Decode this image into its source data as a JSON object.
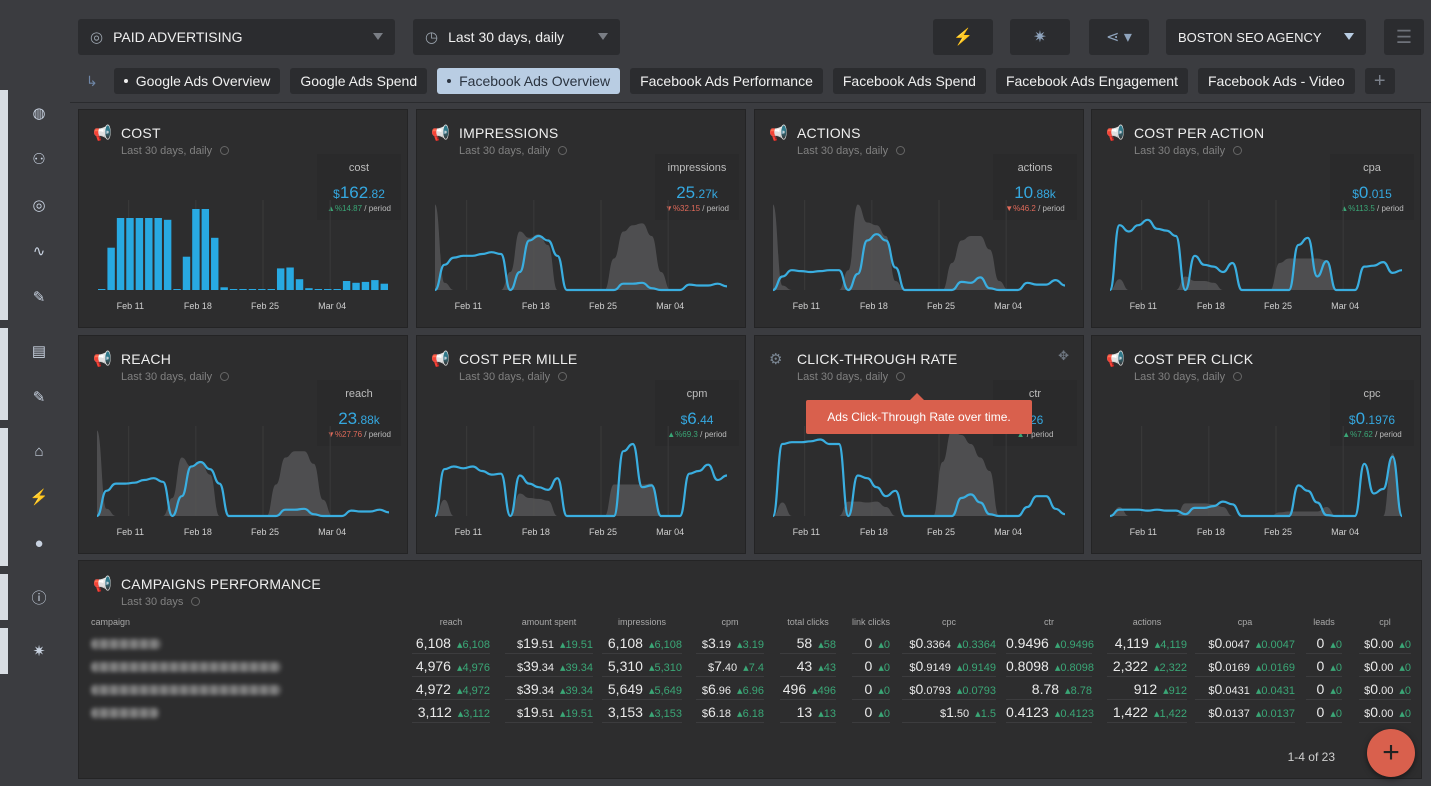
{
  "topbar": {
    "dashboard_select": {
      "label": "PAID ADVERTISING",
      "icon": "target-icon"
    },
    "period_select": {
      "label": "Last 30 days, daily",
      "icon": "clock-icon"
    },
    "buttons": [
      {
        "name": "plug-icon",
        "glyph": "⚡"
      },
      {
        "name": "bug-icon",
        "glyph": "✷"
      },
      {
        "name": "share-icon",
        "glyph": "⋖"
      }
    ],
    "agency_select": {
      "label": "BOSTON SEO AGENCY"
    },
    "menu_icon": "☰"
  },
  "tabs": [
    {
      "label": "Google Ads Overview",
      "dot": true,
      "active": false
    },
    {
      "label": "Google Ads Spend",
      "dot": false,
      "active": false
    },
    {
      "label": "Facebook Ads Overview",
      "dot": true,
      "active": true
    },
    {
      "label": "Facebook Ads Performance",
      "dot": false,
      "active": false
    },
    {
      "label": "Facebook Ads Spend",
      "dot": false,
      "active": false
    },
    {
      "label": "Facebook Ads Engagement",
      "dot": false,
      "active": false
    },
    {
      "label": "Facebook Ads - Video",
      "dot": false,
      "active": false
    }
  ],
  "tab_add": "+",
  "sidebar": [
    {
      "group": [
        {
          "name": "globe-icon",
          "g": "◍"
        },
        {
          "name": "users-icon",
          "g": "⚇"
        },
        {
          "name": "target-icon",
          "g": "◎"
        },
        {
          "name": "analytics-icon",
          "g": "∿"
        },
        {
          "name": "edit-icon",
          "g": "✎"
        }
      ]
    },
    {
      "group": [
        {
          "name": "clipboard-icon",
          "g": "▤"
        },
        {
          "name": "edit-icon",
          "g": "✎"
        }
      ]
    },
    {
      "group": [
        {
          "name": "bank-icon",
          "g": "⌂"
        },
        {
          "name": "plug-icon",
          "g": "⚡"
        },
        {
          "name": "account-icon",
          "g": "●"
        }
      ]
    },
    {
      "group": [
        {
          "name": "info-icon",
          "g": "ⓘ"
        }
      ]
    },
    {
      "group": [
        {
          "name": "bug-icon",
          "g": "✷"
        }
      ]
    }
  ],
  "widgets": [
    {
      "title": "COST",
      "subtitle": "Last 30 days, daily",
      "kpi_label": "cost",
      "prefix": "$",
      "value_main": "162",
      "value_dec": ".82",
      "change_dir": "up",
      "change": "%14.87",
      "period": " / period",
      "icon": "megaphone-icon"
    },
    {
      "title": "IMPRESSIONS",
      "subtitle": "Last 30 days, daily",
      "kpi_label": "impressions",
      "prefix": "",
      "value_main": "25",
      "value_dec": ".27k",
      "change_dir": "down",
      "change": "%32.15",
      "period": " / period",
      "icon": "megaphone-icon"
    },
    {
      "title": "ACTIONS",
      "subtitle": "Last 30 days, daily",
      "kpi_label": "actions",
      "prefix": "",
      "value_main": "10",
      "value_dec": ".88k",
      "change_dir": "down",
      "change": "%46.2",
      "period": " / period",
      "icon": "megaphone-icon"
    },
    {
      "title": "COST PER ACTION",
      "subtitle": "Last 30 days, daily",
      "kpi_label": "cpa",
      "prefix": "$",
      "value_main": "0",
      "value_dec": ".015",
      "change_dir": "up",
      "change": "%113.5",
      "period": " / period",
      "icon": "megaphone-icon"
    },
    {
      "title": "REACH",
      "subtitle": "Last 30 days, daily",
      "kpi_label": "reach",
      "prefix": "",
      "value_main": "23",
      "value_dec": ".88k",
      "change_dir": "down",
      "change": "%27.76",
      "period": " / period",
      "icon": "megaphone-icon"
    },
    {
      "title": "COST PER MILLE",
      "subtitle": "Last 30 days, daily",
      "kpi_label": "cpm",
      "prefix": "$",
      "value_main": "6",
      "value_dec": ".44",
      "change_dir": "up",
      "change": "%69.3",
      "period": " / period",
      "icon": "megaphone-icon"
    },
    {
      "title": "CLICK-THROUGH RATE",
      "subtitle": "Last 30 days, daily",
      "kpi_label": "ctr",
      "prefix": "",
      "value_main": "",
      "value_dec": ".26",
      "change_dir": "up",
      "change": "",
      "period": " / period",
      "icon": "gear-icon"
    },
    {
      "title": "COST PER CLICK",
      "subtitle": "Last 30 days, daily",
      "kpi_label": "cpc",
      "prefix": "$",
      "value_main": "0",
      "value_dec": ".1976",
      "change_dir": "up",
      "change": "%7.62",
      "period": " / period",
      "icon": "megaphone-icon"
    }
  ],
  "tooltip": "Ads Click-Through Rate over time.",
  "chart_data": [
    {
      "type": "bar",
      "title": "COST",
      "x_ticks": [
        "Feb 11",
        "Feb 18",
        "Feb 25",
        "Mar 04"
      ],
      "values": [
        0,
        47,
        80,
        80,
        80,
        80,
        80,
        78,
        0,
        37,
        90,
        90,
        58,
        3,
        0,
        0,
        0,
        0,
        0,
        24,
        25,
        12,
        2,
        0,
        0,
        0,
        10,
        8,
        9,
        11,
        7
      ]
    },
    {
      "type": "area",
      "title": "IMPRESSIONS",
      "x_ticks": [
        "Feb 11",
        "Feb 18",
        "Feb 25",
        "Mar 04"
      ],
      "line": [
        0,
        28,
        36,
        38,
        38,
        40,
        42,
        40,
        0,
        20,
        55,
        60,
        55,
        38,
        0,
        0,
        0,
        0,
        0,
        0,
        7,
        7,
        8,
        2,
        0,
        0,
        0,
        6,
        5,
        5,
        7,
        4
      ],
      "compare": [
        95,
        8,
        0,
        0,
        0,
        0,
        0,
        0,
        20,
        65,
        58,
        62,
        50,
        0,
        0,
        0,
        0,
        0,
        0,
        35,
        65,
        72,
        74,
        60,
        20,
        0,
        0,
        0,
        0,
        0,
        0,
        0
      ]
    },
    {
      "type": "area",
      "title": "ACTIONS",
      "x_ticks": [
        "Feb 11",
        "Feb 18",
        "Feb 25",
        "Mar 04"
      ],
      "line": [
        0,
        15,
        22,
        21,
        20,
        21,
        22,
        22,
        0,
        18,
        55,
        62,
        55,
        25,
        0,
        0,
        0,
        0,
        0,
        0,
        9,
        8,
        14,
        2,
        0,
        0,
        0,
        8,
        6,
        6,
        11,
        5
      ],
      "compare": [
        95,
        5,
        0,
        0,
        0,
        0,
        0,
        0,
        22,
        95,
        75,
        72,
        60,
        10,
        0,
        0,
        0,
        0,
        0,
        30,
        55,
        60,
        60,
        45,
        10,
        0,
        0,
        0,
        0,
        0,
        0,
        0
      ]
    },
    {
      "type": "area",
      "title": "COST PER ACTION",
      "x_ticks": [
        "Feb 11",
        "Feb 18",
        "Feb 25",
        "Mar 04"
      ],
      "line": [
        0,
        72,
        65,
        72,
        78,
        68,
        66,
        60,
        0,
        38,
        28,
        26,
        20,
        30,
        0,
        0,
        0,
        0,
        0,
        0,
        50,
        58,
        15,
        32,
        0,
        0,
        0,
        26,
        27,
        31,
        19,
        22
      ],
      "compare": [
        0,
        12,
        0,
        0,
        0,
        0,
        0,
        0,
        15,
        10,
        10,
        8,
        0,
        0,
        0,
        0,
        0,
        0,
        30,
        35,
        35,
        35,
        35,
        33,
        0,
        0,
        0,
        0,
        0,
        0,
        0,
        0
      ]
    },
    {
      "type": "area",
      "title": "REACH",
      "x_ticks": [
        "Feb 11",
        "Feb 18",
        "Feb 25",
        "Mar 04"
      ],
      "line": [
        0,
        28,
        36,
        36,
        37,
        40,
        42,
        38,
        0,
        22,
        55,
        60,
        52,
        36,
        0,
        0,
        0,
        0,
        0,
        0,
        7,
        7,
        8,
        2,
        0,
        0,
        0,
        6,
        5,
        5,
        7,
        4
      ],
      "compare": [
        95,
        8,
        0,
        0,
        0,
        0,
        0,
        0,
        20,
        65,
        55,
        60,
        46,
        0,
        0,
        0,
        0,
        0,
        0,
        35,
        65,
        72,
        72,
        58,
        18,
        0,
        0,
        0,
        0,
        0,
        0,
        0
      ]
    },
    {
      "type": "area",
      "title": "COST PER MILLE",
      "x_ticks": [
        "Feb 11",
        "Feb 18",
        "Feb 25",
        "Mar 04"
      ],
      "line": [
        0,
        52,
        55,
        53,
        55,
        50,
        46,
        47,
        0,
        45,
        36,
        32,
        29,
        42,
        0,
        0,
        0,
        0,
        0,
        0,
        72,
        80,
        32,
        34,
        0,
        0,
        0,
        47,
        50,
        57,
        40,
        45
      ],
      "compare": [
        0,
        18,
        0,
        0,
        0,
        0,
        0,
        0,
        0,
        25,
        20,
        19,
        17,
        0,
        0,
        0,
        0,
        0,
        0,
        35,
        35,
        35,
        35,
        36,
        0,
        0,
        0,
        0,
        0,
        0,
        0,
        0
      ]
    },
    {
      "type": "area",
      "title": "CLICK-THROUGH RATE",
      "x_ticks": [
        "Feb 11",
        "Feb 18",
        "Feb 25",
        "Mar 04"
      ],
      "line": [
        0,
        80,
        82,
        82,
        83,
        85,
        80,
        80,
        0,
        45,
        42,
        32,
        22,
        28,
        0,
        0,
        0,
        0,
        0,
        0,
        20,
        24,
        15,
        2,
        0,
        0,
        0,
        10,
        22,
        22,
        8,
        2
      ],
      "compare": [
        0,
        15,
        0,
        0,
        0,
        0,
        0,
        0,
        16,
        16,
        15,
        16,
        10,
        0,
        0,
        0,
        0,
        0,
        60,
        95,
        90,
        80,
        65,
        50,
        0,
        0,
        0,
        0,
        0,
        0,
        0,
        0
      ]
    },
    {
      "type": "area",
      "title": "COST PER CLICK",
      "x_ticks": [
        "Feb 11",
        "Feb 18",
        "Feb 25",
        "Mar 04"
      ],
      "line": [
        0,
        7,
        7,
        7,
        6,
        7,
        6,
        6,
        2,
        9,
        9,
        11,
        16,
        13,
        0,
        0,
        0,
        0,
        0,
        0,
        34,
        28,
        15,
        1,
        0,
        0,
        0,
        58,
        25,
        30,
        66,
        0
      ],
      "compare": [
        0,
        10,
        0,
        0,
        0,
        0,
        0,
        0,
        14,
        14,
        14,
        13,
        10,
        0,
        0,
        0,
        0,
        0,
        4,
        5,
        5,
        5,
        5,
        10,
        0,
        0,
        0,
        0,
        0,
        0,
        70,
        0
      ]
    }
  ],
  "campaigns": {
    "title": "CAMPAIGNS PERFORMANCE",
    "subtitle": "Last 30 days",
    "headers": [
      "campaign",
      "reach",
      "amount spent",
      "impressions",
      "cpm",
      "total clicks",
      "link clicks",
      "cpc",
      "ctr",
      "actions",
      "cpa",
      "leads",
      "cpl"
    ],
    "rows": [
      {
        "cells": [
          [
            "6,108",
            "",
            "",
            "6,108"
          ],
          [
            "$",
            "19",
            ".51",
            "19.51"
          ],
          [
            "6,108",
            "",
            "",
            "6,108"
          ],
          [
            "$",
            "3",
            ".19",
            "3.19"
          ],
          [
            "58",
            "",
            "",
            "58"
          ],
          [
            "0",
            "",
            "",
            "0"
          ],
          [
            "$",
            "0",
            ".3364",
            "0.3364"
          ],
          [
            "0",
            ".9496",
            "",
            "0.9496"
          ],
          [
            "4,119",
            "",
            "",
            "4,119"
          ],
          [
            "$",
            "0",
            ".0047",
            "0.0047"
          ],
          [
            "0",
            "",
            "",
            "0"
          ],
          [
            "$",
            "0",
            ".00",
            "0"
          ]
        ]
      },
      {
        "cells": [
          [
            "4,976",
            "",
            "",
            "4,976"
          ],
          [
            "$",
            "39",
            ".34",
            "39.34"
          ],
          [
            "5,310",
            "",
            "",
            "5,310"
          ],
          [
            "$",
            "7",
            ".40",
            "7.4"
          ],
          [
            "43",
            "",
            "",
            "43"
          ],
          [
            "0",
            "",
            "",
            "0"
          ],
          [
            "$",
            "0",
            ".9149",
            "0.9149"
          ],
          [
            "0",
            ".8098",
            "",
            "0.8098"
          ],
          [
            "2,322",
            "",
            "",
            "2,322"
          ],
          [
            "$",
            "0",
            ".0169",
            "0.0169"
          ],
          [
            "0",
            "",
            "",
            "0"
          ],
          [
            "$",
            "0",
            ".00",
            "0"
          ]
        ]
      },
      {
        "cells": [
          [
            "4,972",
            "",
            "",
            "4,972"
          ],
          [
            "$",
            "39",
            ".34",
            "39.34"
          ],
          [
            "5,649",
            "",
            "",
            "5,649"
          ],
          [
            "$",
            "6",
            ".96",
            "6.96"
          ],
          [
            "496",
            "",
            "",
            "496"
          ],
          [
            "0",
            "",
            "",
            "0"
          ],
          [
            "$",
            "0",
            ".0793",
            "0.0793"
          ],
          [
            "8",
            ".78",
            "",
            "8.78"
          ],
          [
            "912",
            "",
            "",
            "912"
          ],
          [
            "$",
            "0",
            ".0431",
            "0.0431"
          ],
          [
            "0",
            "",
            "",
            "0"
          ],
          [
            "$",
            "0",
            ".00",
            "0"
          ]
        ]
      },
      {
        "cells": [
          [
            "3,112",
            "",
            "",
            "3,112"
          ],
          [
            "$",
            "19",
            ".51",
            "19.51"
          ],
          [
            "3,153",
            "",
            "",
            "3,153"
          ],
          [
            "$",
            "6",
            ".18",
            "6.18"
          ],
          [
            "13",
            "",
            "",
            "13"
          ],
          [
            "0",
            "",
            "",
            "0"
          ],
          [
            "$",
            "1",
            ".50",
            "1.5"
          ],
          [
            "0",
            ".4123",
            "",
            "0.4123"
          ],
          [
            "1,422",
            "",
            "",
            "1,422"
          ],
          [
            "$",
            "0",
            ".0137",
            "0.0137"
          ],
          [
            "0",
            "",
            "",
            "0"
          ],
          [
            "$",
            "0",
            ".00",
            "0"
          ]
        ]
      }
    ],
    "pager": "1-4 of 23"
  },
  "fab": "+"
}
